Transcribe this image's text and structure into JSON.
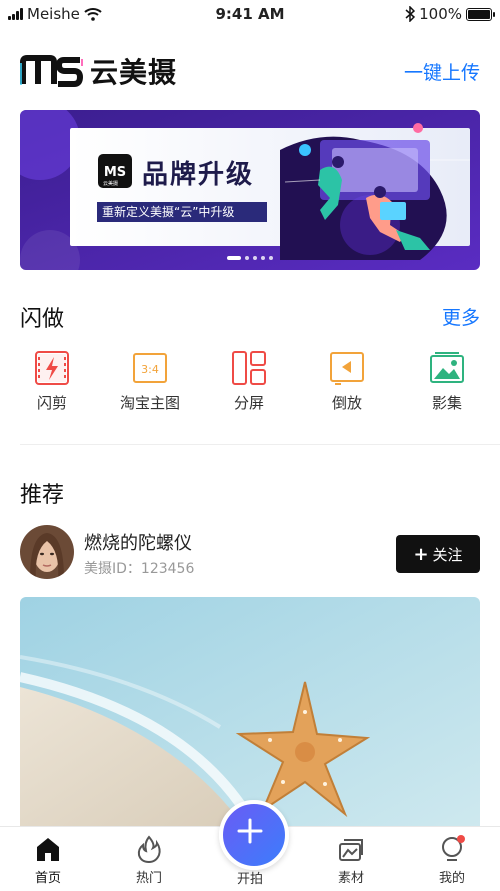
{
  "status": {
    "carrier": "Meishe",
    "time": "9:41 AM",
    "battery": "100%"
  },
  "header": {
    "logo_text": "MS",
    "title": "云美摄",
    "upload_label": "一键上传"
  },
  "banner": {
    "headline": "品牌升级",
    "subline": "重新定义美摄“云”中升级",
    "logo_caption": "云美摄",
    "slides": 5,
    "active_slide": 1
  },
  "quick": {
    "title": "闪做",
    "more": "更多",
    "items": [
      {
        "label": "闪剪",
        "icon": "flash-cut-icon",
        "color": "#ef4b46"
      },
      {
        "label": "淘宝主图",
        "icon": "ratio-3-4-icon",
        "icon_text": "3:4",
        "color": "#f2a33a"
      },
      {
        "label": "分屏",
        "icon": "split-screen-icon",
        "color": "#ef4b46"
      },
      {
        "label": "倒放",
        "icon": "reverse-play-icon",
        "color": "#f2a33a"
      },
      {
        "label": "影集",
        "icon": "album-icon",
        "color": "#2eb37f"
      }
    ]
  },
  "recommend": {
    "title": "推荐",
    "user": {
      "name": "燃烧的陀螺仪",
      "id_label": "美摄ID：123456"
    },
    "follow_label": "关注"
  },
  "tabbar": {
    "items": [
      {
        "label": "首页",
        "icon": "home-icon",
        "active": true
      },
      {
        "label": "热门",
        "icon": "flame-icon"
      },
      {
        "label": "开拍",
        "icon": "plus-icon"
      },
      {
        "label": "素材",
        "icon": "material-icon"
      },
      {
        "label": "我的",
        "icon": "profile-icon",
        "badge": true
      }
    ]
  },
  "colors": {
    "accent": "#1677ff",
    "dark": "#111111",
    "badge": "#ef4b46"
  }
}
